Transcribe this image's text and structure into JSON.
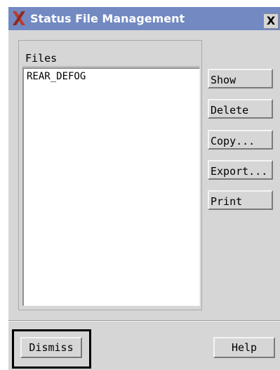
{
  "window": {
    "title": "Status File Management",
    "close_label": "X"
  },
  "files": {
    "header": "Files",
    "items": [
      "REAR_DEFOG"
    ]
  },
  "actions": {
    "show": "Show",
    "delete": "Delete",
    "copy": "Copy...",
    "export": "Export...",
    "print": "Print"
  },
  "footer": {
    "dismiss": "Dismiss",
    "help": "Help"
  },
  "icons": {
    "app": "x-logo-icon",
    "close": "close-icon"
  },
  "colors": {
    "titlebar": "#7289c2",
    "background": "#d6d6d6",
    "logo": "#c0392b"
  }
}
